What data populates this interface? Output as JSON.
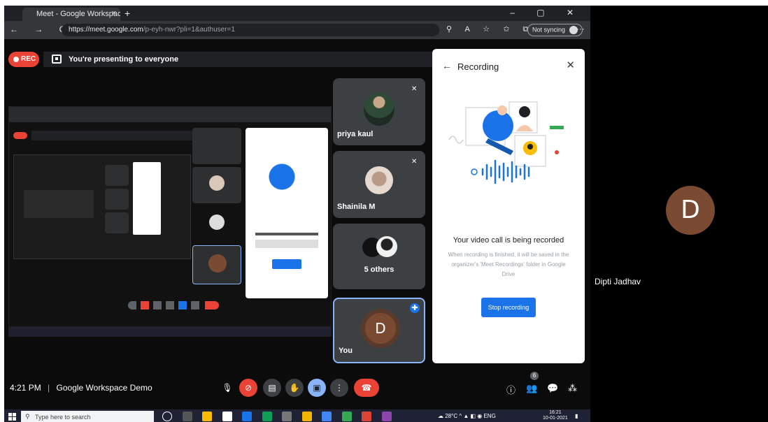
{
  "browser": {
    "tab_title": "Meet - Google Workspace",
    "tab_close": "×",
    "new_tab": "+",
    "window_buttons": "– ▢ ✕",
    "nav": "← → C",
    "url_host": "https://meet.google.com",
    "url_path": "/p-eyh-nwr?pli=1&authuser=1",
    "sync_label": "Not syncing",
    "menu": "···"
  },
  "meet": {
    "rec_label": "REC",
    "presenting_text": "You're presenting to everyone",
    "clock": "4:21 PM",
    "separator": "|",
    "meeting_name": "Google Workspace Demo",
    "participant_badge": "6"
  },
  "participants": [
    {
      "name": "priya kaul"
    },
    {
      "name": "Shainila M"
    },
    {
      "name": "5 others"
    },
    {
      "name": "You",
      "initial": "D"
    }
  ],
  "recording_panel": {
    "title": "Recording",
    "heading": "Your video call is being recorded",
    "body": "When recording is finished, it will be saved in the organizer's 'Meet Recordings' folder in Google Drive",
    "stop_button": "Stop recording"
  },
  "taskbar": {
    "search_placeholder": "Type here to search",
    "weather": "28°C",
    "lang": "ENG",
    "time": "16:21",
    "date": "10-01-2021"
  },
  "side_participant": {
    "initial": "D",
    "name": "Dipti Jadhav"
  },
  "colors": {
    "accent_blue": "#1a73e8",
    "record_red": "#ea4335",
    "avatar_brown": "#7b4a32",
    "tile_gray": "#3c4043"
  }
}
